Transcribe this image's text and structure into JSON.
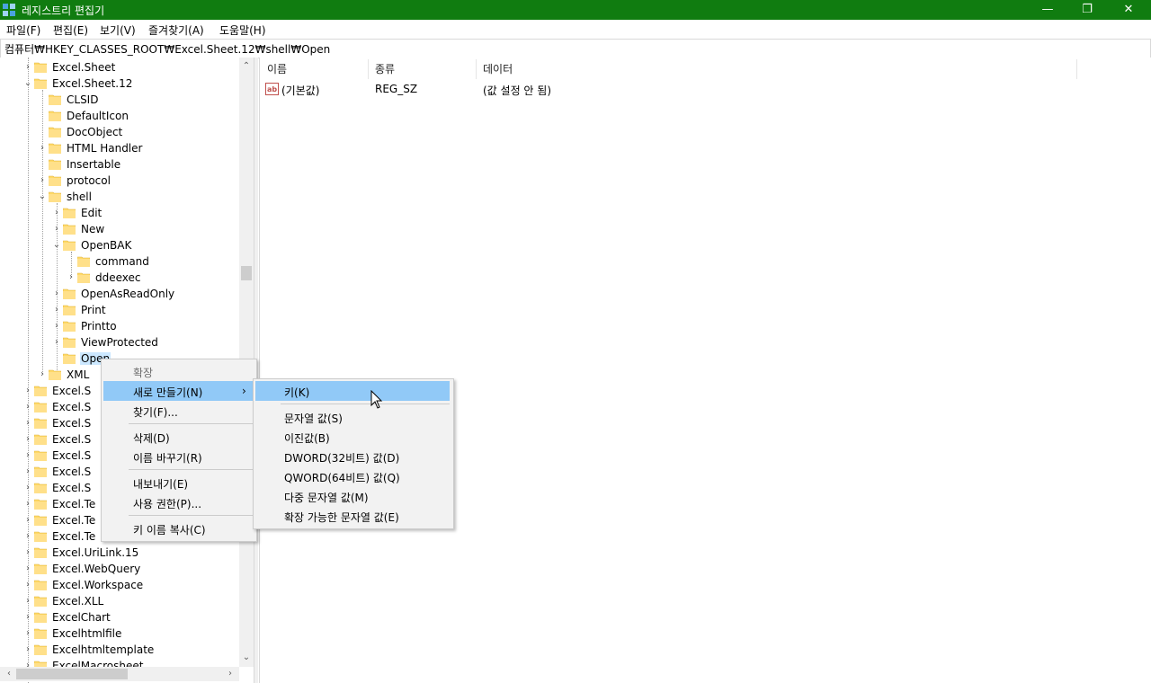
{
  "window": {
    "title": "레지스트리 편집기",
    "minimize": "—",
    "restore": "❐",
    "close": "✕"
  },
  "menu": [
    "파일(F)",
    "편집(E)",
    "보기(V)",
    "즐겨찾기(A)",
    "도움말(H)"
  ],
  "address": "컴퓨터₩HKEY_CLASSES_ROOT₩Excel.Sheet.12₩shell₩Open",
  "tree": [
    {
      "label": "Excel.Sheet",
      "chev": "›"
    },
    {
      "label": "Excel.Sheet.12",
      "chev": "⌄"
    },
    {
      "label": "CLSID",
      "chev": ""
    },
    {
      "label": "DefaultIcon",
      "chev": ""
    },
    {
      "label": "DocObject",
      "chev": ""
    },
    {
      "label": "HTML Handler",
      "chev": "›"
    },
    {
      "label": "Insertable",
      "chev": ""
    },
    {
      "label": "protocol",
      "chev": "›"
    },
    {
      "label": "shell",
      "chev": "⌄"
    },
    {
      "label": "Edit",
      "chev": "›"
    },
    {
      "label": "New",
      "chev": "›"
    },
    {
      "label": "OpenBAK",
      "chev": "⌄"
    },
    {
      "label": "command",
      "chev": ""
    },
    {
      "label": "ddeexec",
      "chev": "›"
    },
    {
      "label": "OpenAsReadOnly",
      "chev": "›"
    },
    {
      "label": "Print",
      "chev": "›"
    },
    {
      "label": "Printto",
      "chev": "›"
    },
    {
      "label": "ViewProtected",
      "chev": "›"
    },
    {
      "label": "Open",
      "chev": ""
    },
    {
      "label": "XML",
      "chev": "›"
    },
    {
      "label": "Excel.S",
      "chev": "›"
    },
    {
      "label": "Excel.S",
      "chev": "›"
    },
    {
      "label": "Excel.S",
      "chev": "›"
    },
    {
      "label": "Excel.S",
      "chev": "›"
    },
    {
      "label": "Excel.S",
      "chev": "›"
    },
    {
      "label": "Excel.S",
      "chev": "›"
    },
    {
      "label": "Excel.S",
      "chev": "›"
    },
    {
      "label": "Excel.Te",
      "chev": "›"
    },
    {
      "label": "Excel.Te",
      "chev": "›"
    },
    {
      "label": "Excel.Te",
      "chev": "›"
    },
    {
      "label": "Excel.UriLink.15",
      "chev": "›"
    },
    {
      "label": "Excel.WebQuery",
      "chev": "›"
    },
    {
      "label": "Excel.Workspace",
      "chev": "›"
    },
    {
      "label": "Excel.XLL",
      "chev": "›"
    },
    {
      "label": "ExcelChart",
      "chev": "›"
    },
    {
      "label": "Excelhtmlfile",
      "chev": "›"
    },
    {
      "label": "Excelhtmltemplate",
      "chev": "›"
    },
    {
      "label": "ExcelMacrosheet",
      "chev": "›"
    }
  ],
  "columns": {
    "name": "이름",
    "type": "종류",
    "data": "데이터"
  },
  "rows": [
    {
      "name": "(기본값)",
      "type": "REG_SZ",
      "data": "(값 설정 안 됨)"
    }
  ],
  "context_menu": {
    "expand": "확장",
    "new": "새로 만들기(N)",
    "new_arrow": "›",
    "find": "찾기(F)...",
    "delete": "삭제(D)",
    "rename": "이름 바꾸기(R)",
    "export": "내보내기(E)",
    "permissions": "사용 권한(P)...",
    "copy_key_name": "키 이름 복사(C)"
  },
  "submenu": {
    "key": "키(K)",
    "string": "문자열 값(S)",
    "binary": "이진값(B)",
    "dword": "DWORD(32비트) 값(D)",
    "qword": "QWORD(64비트) 값(Q)",
    "multi_string": "다중 문자열 값(M)",
    "expand_string": "확장 가능한 문자열 값(E)"
  },
  "colors": {
    "titlebar": "#107c10",
    "highlight": "#91c9f7",
    "selection": "#cce8ff",
    "folder": "#ffd967"
  }
}
